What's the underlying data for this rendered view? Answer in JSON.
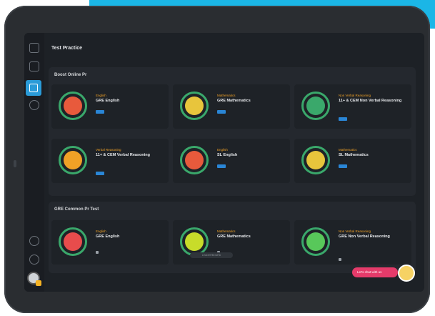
{
  "page": {
    "title": "Test Practice"
  },
  "sections": [
    {
      "title": "Boost Online Pr",
      "cards": [
        {
          "sub": "English",
          "name": "GRE English",
          "icon": "chef-icon",
          "color": "#e85a3c"
        },
        {
          "sub": "Mathematics",
          "name": "GRE Mathematics",
          "icon": "stack-icon",
          "color": "#e8c53c"
        },
        {
          "sub": "Non Verbal Reasoning",
          "name": "11+ & CEM Non Verbal Reasoning",
          "icon": "chart-icon",
          "color": "#3aa86b"
        },
        {
          "sub": "Verbal Reasoning",
          "name": "11+ & CEM Verbal Reasoning",
          "icon": "orbit-icon",
          "color": "#f0a126"
        },
        {
          "sub": "English",
          "name": "SL English",
          "icon": "dart-icon",
          "color": "#e85a3c"
        },
        {
          "sub": "Mathematics",
          "name": "SL Mathematics",
          "icon": "lab-icon",
          "color": "#e8c53c"
        }
      ]
    },
    {
      "title": "GRE Common Pr Test",
      "cards": [
        {
          "sub": "English",
          "name": "GRE English",
          "icon": "flower-icon",
          "color": "#e84c4c"
        },
        {
          "sub": "Mathematics",
          "name": "GRE Mathematics",
          "icon": "clock-icon",
          "color": "#c8dc2a"
        },
        {
          "sub": "Non Verbal Reasoning",
          "name": "GRE Non Verbal Reasoning",
          "icon": "leaf-icon",
          "color": "#58c85a"
        }
      ]
    }
  ],
  "footer_pill": "LEADERBOARD",
  "chat_button": "Let's chat with us",
  "colors": {
    "accent": "#2a9bd8",
    "cta": "#e53b6a"
  }
}
